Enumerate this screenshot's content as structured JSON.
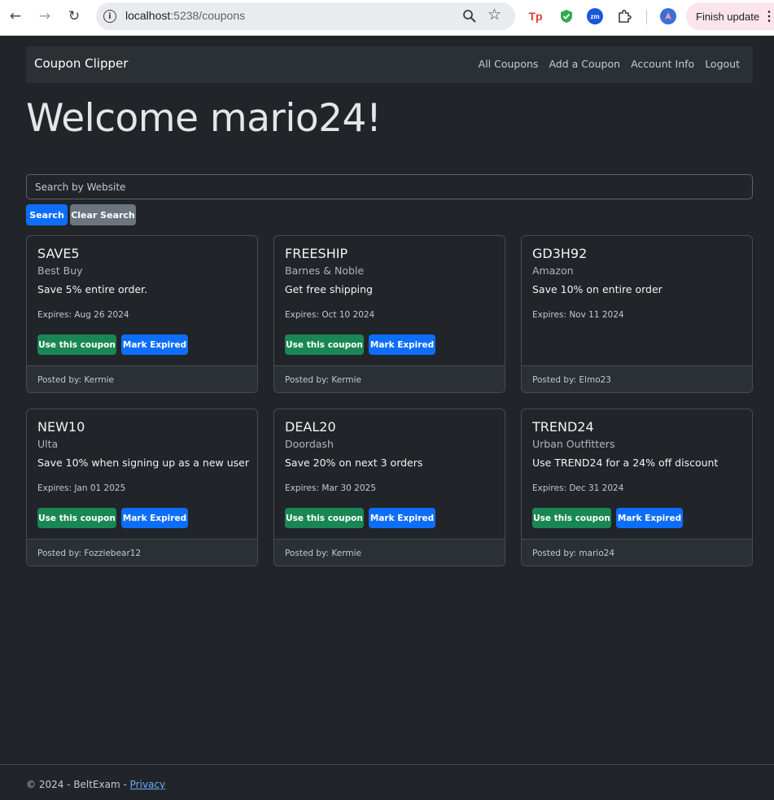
{
  "browser": {
    "url_host": "localhost",
    "url_path": ":5238/coupons",
    "finish_update": "Finish update",
    "ext_tp": "Tp",
    "ext_zm": "zm"
  },
  "navbar": {
    "brand": "Coupon Clipper",
    "links": [
      "All Coupons",
      "Add a Coupon",
      "Account Info",
      "Logout"
    ]
  },
  "welcome": "Welcome mario24!",
  "search": {
    "placeholder": "Search by Website",
    "search_label": "Search",
    "clear_label": "Clear Search"
  },
  "coupons": [
    {
      "code": "SAVE5",
      "site": "Best Buy",
      "desc": "Save 5% entire order.",
      "expires": "Expires: Aug 26 2024",
      "use_label": "Use this coupon",
      "mark_label": "Mark Expired",
      "posted": "Posted by: Kermie"
    },
    {
      "code": "FREESHIP",
      "site": "Barnes & Noble",
      "desc": "Get free shipping",
      "expires": "Expires: Oct 10 2024",
      "use_label": "Use this coupon",
      "mark_label": "Mark Expired",
      "posted": "Posted by: Kermie"
    },
    {
      "code": "GD3H92",
      "site": "Amazon",
      "desc": "Save 10% on entire order",
      "expires": "Expires: Nov 11 2024",
      "posted": "Posted by: Elmo23"
    },
    {
      "code": "NEW10",
      "site": "Ulta",
      "desc": "Save 10% when signing up as a new user",
      "expires": "Expires: Jan 01 2025",
      "use_label": "Use this coupon",
      "mark_label": "Mark Expired",
      "posted": "Posted by: Fozziebear12"
    },
    {
      "code": "DEAL20",
      "site": "Doordash",
      "desc": "Save 20% on next 3 orders",
      "expires": "Expires: Mar 30 2025",
      "use_label": "Use this coupon",
      "mark_label": "Mark Expired",
      "posted": "Posted by: Kermie"
    },
    {
      "code": "TREND24",
      "site": "Urban Outfitters",
      "desc": "Use TREND24 for a 24% off discount",
      "expires": "Expires: Dec 31 2024",
      "use_label": "Use this coupon",
      "mark_label": "Mark Expired",
      "posted": "Posted by: mario24"
    }
  ],
  "footer": {
    "text": "© 2024 - BeltExam - ",
    "privacy": "Privacy"
  },
  "colors": {
    "background": "#212529",
    "primary": "#0d6efd",
    "success": "#198754",
    "secondary": "#6c757d"
  }
}
